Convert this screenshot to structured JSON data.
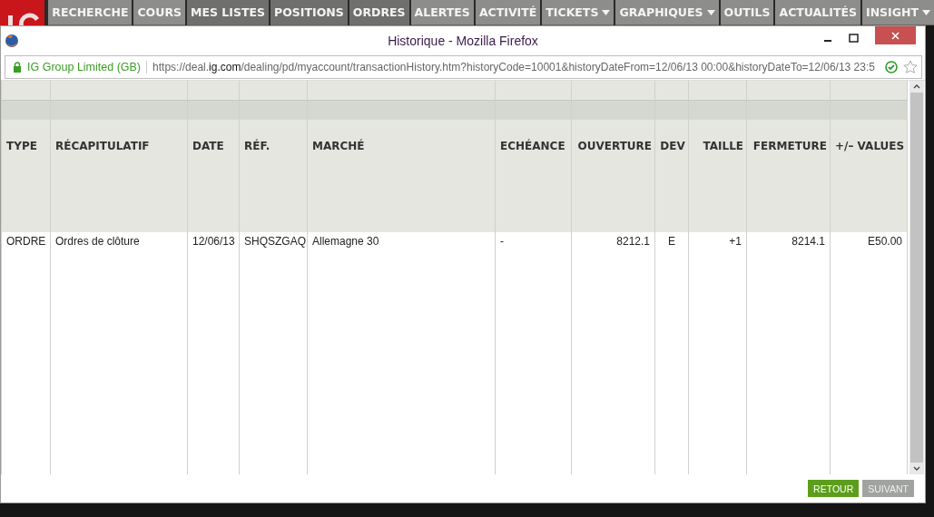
{
  "nav": {
    "tabs": [
      {
        "label": "RECHERCHE",
        "kind": "light",
        "dropdown": false
      },
      {
        "label": "COURS",
        "kind": "light",
        "dropdown": false
      },
      {
        "label": "MES LISTES",
        "kind": "dark",
        "dropdown": false
      },
      {
        "label": "POSITIONS",
        "kind": "dark",
        "dropdown": false
      },
      {
        "label": "ORDRES",
        "kind": "dark",
        "dropdown": false
      },
      {
        "label": "ALERTES",
        "kind": "light",
        "dropdown": false
      },
      {
        "label": "ACTIVITÉ",
        "kind": "light",
        "dropdown": false
      },
      {
        "label": "TICKETS",
        "kind": "light",
        "dropdown": true
      },
      {
        "label": "GRAPHIQUES",
        "kind": "light",
        "dropdown": true
      },
      {
        "label": "OUTILS",
        "kind": "light",
        "dropdown": false
      },
      {
        "label": "ACTUALITÉS",
        "kind": "light",
        "dropdown": false
      },
      {
        "label": "INSIGHT",
        "kind": "light",
        "dropdown": true
      }
    ]
  },
  "window": {
    "title": "Historique - Mozilla Firefox"
  },
  "address_bar": {
    "identity": "IG Group Limited (GB)",
    "url_prefix": "https://deal.",
    "url_domain": "ig.com",
    "url_rest": "/dealing/pd/myaccount/transactionHistory.htm?historyCode=10001&historyDateFrom=12/06/13 00:00&historyDateTo=12/06/13 23:5"
  },
  "table": {
    "columns": [
      "TYPE",
      "RÉCAPITULATIF",
      "DATE",
      "RÉF.",
      "MARCHÉ",
      "ECHÉANCE",
      "OUVERTURE",
      "DEV",
      "TAILLE",
      "FERMETURE",
      "+/– VALUES"
    ],
    "rows": [
      [
        "ORDRE",
        "Ordres de clôture",
        "12/06/13",
        "SHQSZGAQ",
        "Allemagne 30",
        "-",
        "8212.1",
        "E",
        "+1",
        "8214.1",
        "E50.00"
      ]
    ]
  },
  "buttons": [
    {
      "label": "RETOUR",
      "disabled": false
    },
    {
      "label": "SUIVANT",
      "disabled": true
    }
  ]
}
